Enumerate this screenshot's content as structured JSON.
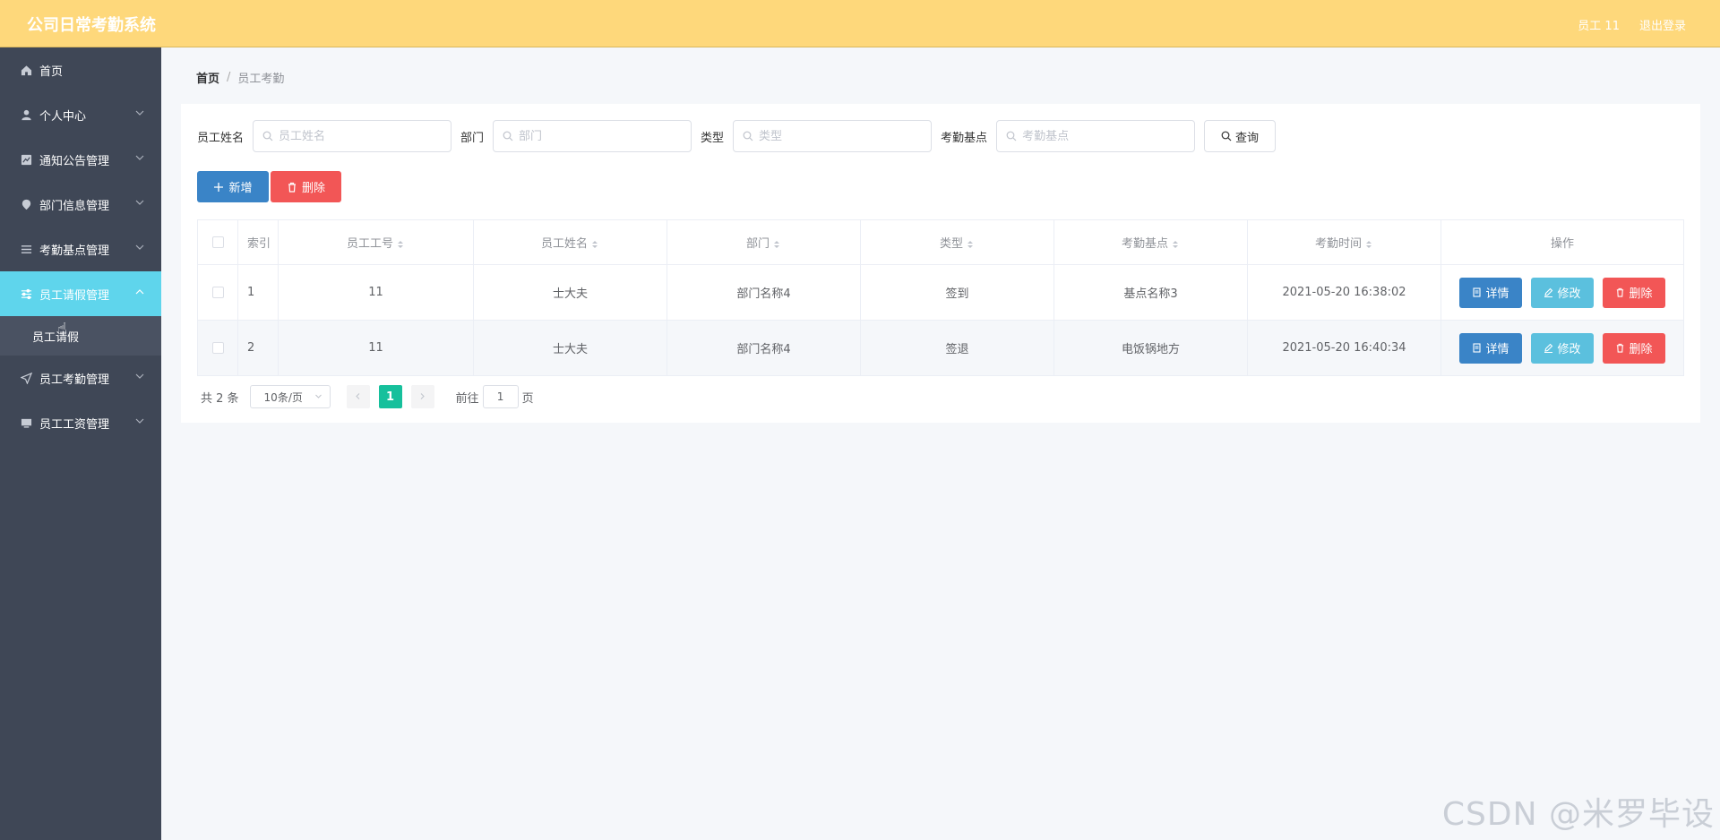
{
  "header": {
    "title": "公司日常考勤系统",
    "user_label": "员工 11",
    "logout_label": "退出登录"
  },
  "sidebar": {
    "items": [
      {
        "label": "首页",
        "icon": "home-icon"
      },
      {
        "label": "个人中心",
        "icon": "user-icon"
      },
      {
        "label": "通知公告管理",
        "icon": "notice-icon"
      },
      {
        "label": "部门信息管理",
        "icon": "location-icon"
      },
      {
        "label": "考勤基点管理",
        "icon": "list-icon"
      },
      {
        "label": "员工请假管理",
        "icon": "sliders-icon"
      },
      {
        "label": "员工考勤管理",
        "icon": "send-icon"
      },
      {
        "label": "员工工资管理",
        "icon": "monitor-icon"
      }
    ],
    "sub_item": "员工请假"
  },
  "breadcrumb": {
    "home": "首页",
    "separator": "/",
    "current": "员工考勤"
  },
  "search": {
    "name_label": "员工姓名",
    "name_placeholder": "员工姓名",
    "dept_label": "部门",
    "dept_placeholder": "部门",
    "type_label": "类型",
    "type_placeholder": "类型",
    "base_label": "考勤基点",
    "base_placeholder": "考勤基点",
    "query_label": "查询"
  },
  "actions": {
    "add_label": "新增",
    "delete_label": "删除"
  },
  "table": {
    "headers": {
      "index": "索引",
      "emp_no": "员工工号",
      "emp_name": "员工姓名",
      "dept": "部门",
      "type": "类型",
      "base": "考勤基点",
      "time": "考勤时间",
      "ops": "操作"
    },
    "rows": [
      {
        "index": "1",
        "emp_no": "11",
        "emp_name": "士大夫",
        "dept": "部门名称4",
        "type": "签到",
        "base": "基点名称3",
        "time": "2021-05-20 16:38:02"
      },
      {
        "index": "2",
        "emp_no": "11",
        "emp_name": "士大夫",
        "dept": "部门名称4",
        "type": "签退",
        "base": "电饭锅地方",
        "time": "2021-05-20 16:40:34"
      }
    ],
    "op_detail": "详情",
    "op_edit": "修改",
    "op_delete": "删除"
  },
  "pagination": {
    "total": "共 2 条",
    "page_size": "10条/页",
    "current_page": "1",
    "goto_prefix": "前往",
    "goto_value": "1",
    "goto_suffix": "页"
  },
  "watermark": "CSDN @米罗毕设",
  "colors": {
    "header": "#fed87b",
    "sidebar": "#3f4756",
    "active": "#5fd5ec",
    "primary": "#3a84c7",
    "danger": "#f25656",
    "info": "#5bc0de",
    "pager": "#16c09c"
  }
}
